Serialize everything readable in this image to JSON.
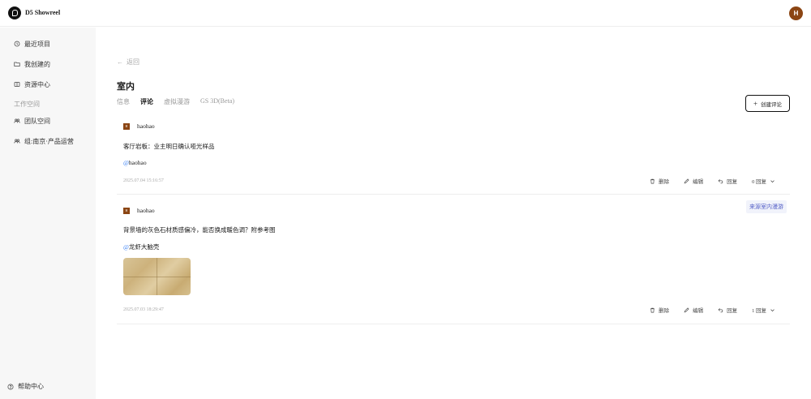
{
  "app": {
    "brand": "D5 Showreel",
    "avatar_initial": "H"
  },
  "sidebar": {
    "items": [
      {
        "label": "最近项目",
        "icon": "history-icon"
      },
      {
        "label": "我创建的",
        "icon": "folder-icon"
      },
      {
        "label": "资源中心",
        "icon": "book-icon"
      }
    ],
    "section_label": "工作空间",
    "workspaces": [
      {
        "label": "团队空间",
        "icon": "team-icon"
      },
      {
        "label": "组:南京·产品运营",
        "icon": "team-icon"
      }
    ],
    "help_label": "帮助中心"
  },
  "page": {
    "back_label": "返回",
    "title": "室内",
    "tabs": [
      "信息",
      "评论",
      "虚拟漫游",
      "GS 3D(Beta)"
    ],
    "active_tab": "评论",
    "create_label": "创建评论"
  },
  "comments": [
    {
      "avatar": "H",
      "user": "haohao",
      "text": "客厅岩板：业主明日确认哑光样品",
      "at": "@",
      "mention": "haohao",
      "time": "2025.07.04 15:16:57",
      "delete": "删除",
      "edit": "编辑",
      "reply": "回复",
      "replies": "0 回复"
    },
    {
      "avatar": "H",
      "user": "haohao",
      "text": "背景墙的灰色石材质感偏冷，能否换成暖色调？附参考图",
      "at": "@",
      "mention": "龙虾大脑壳",
      "source_tag": "来源室内漫游",
      "time": "2025.07.03 18:29:47",
      "delete": "删除",
      "edit": "编辑",
      "reply": "回复",
      "replies": "1 回复"
    }
  ],
  "colors": {
    "accent": "#3b82f6",
    "avatar": "#8b4513",
    "tag_bg": "#f1f3fb",
    "tag_text": "#5560c7"
  }
}
